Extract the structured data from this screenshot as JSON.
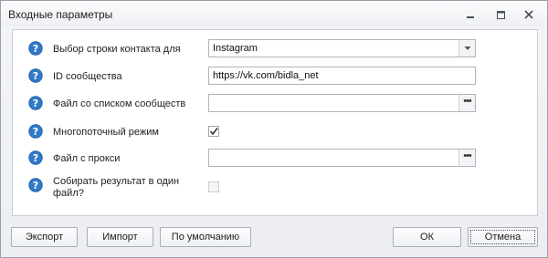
{
  "window": {
    "title": "Входные параметры"
  },
  "rows": [
    {
      "label": "Выбор строки контакта для",
      "type": "dropdown",
      "value": "Instagram"
    },
    {
      "label": "ID сообщества",
      "type": "text",
      "value": "https://vk.com/bidla_net"
    },
    {
      "label": "Файл со списком сообществ",
      "type": "file",
      "value": ""
    },
    {
      "label": "Многопоточный режим",
      "type": "checkbox",
      "checked": true
    },
    {
      "label": "Файл с прокси",
      "type": "file",
      "value": ""
    },
    {
      "label": "Собирать результат в один файл?",
      "type": "checkbox",
      "checked": false
    }
  ],
  "buttons": {
    "export": "Экспорт",
    "import": "Импорт",
    "default": "По умолчанию",
    "ok": "ОК",
    "cancel": "Отмена"
  },
  "colors": {
    "help_icon": "#2f79c8",
    "accent": "#2f79c8"
  }
}
